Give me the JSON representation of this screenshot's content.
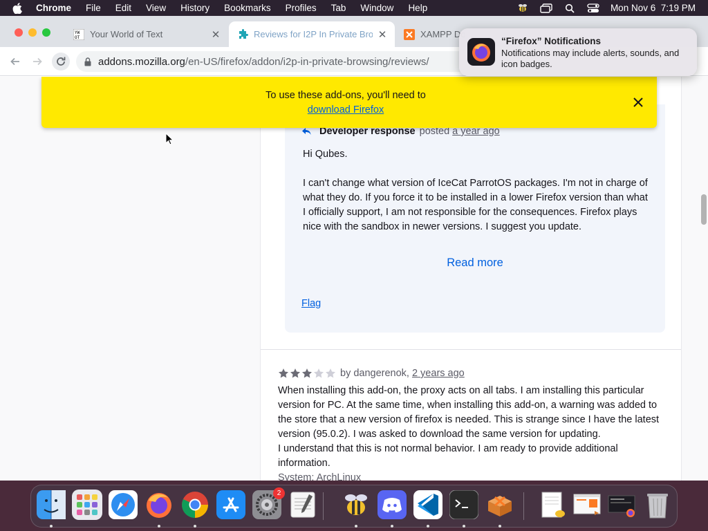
{
  "menubar": {
    "app_name": "Chrome",
    "items": [
      "File",
      "Edit",
      "View",
      "History",
      "Bookmarks",
      "Profiles",
      "Tab",
      "Window",
      "Help"
    ],
    "clock": "Mon Nov 6  7:19 PM"
  },
  "tabs": [
    {
      "title": "Your World of Text",
      "favicon": "ywot-favicon"
    },
    {
      "title": "Reviews for I2P In Private Brow",
      "favicon": "addons-puzzle-favicon",
      "active": true
    },
    {
      "title": "XAMPP Do",
      "favicon": "xampp-favicon"
    }
  ],
  "address_bar": {
    "host": "addons.mozilla.org",
    "path": "/en-US/firefox/addon/i2p-in-private-browsing/reviews/"
  },
  "banner": {
    "text": "To use these add-ons, you'll need to",
    "link": "download Firefox"
  },
  "developer_response": {
    "label": "Developer response",
    "posted": "posted",
    "date": "a year ago",
    "greeting": "Hi Qubes.",
    "body": "I can't change what version of IceCat ParrotOS packages. I'm not in charge of what they do. If you force it to be installed in a lower Firefox version than what I officially support, I am not responsible for the consequences. Firefox plays nice with the sandbox in newer versions. I suggest you update.",
    "read_more": "Read more",
    "flag": "Flag"
  },
  "review": {
    "rating": 3,
    "max_rating": 5,
    "author": "by dangerenok,",
    "date": "2 years ago",
    "body": "When installing this add-on, the proxy acts on all tabs. I am installing this particular version for PC. At the same time, when installing this add-on, a warning was added to the store that a new version of firefox is needed. This is strange since I have the latest version (95.0.2). I was asked to download the same version for updating.",
    "body2": "I understand that this is not normal behavior. I am ready to provide additional information.",
    "system": "System: ArchLinux"
  },
  "notification": {
    "title": "“Firefox” Notifications",
    "body": "Notifications may include alerts, sounds, and icon badges."
  },
  "dock": {
    "settings_badge": "2"
  },
  "colors": {
    "banner_yellow": "#ffe900",
    "link_blue": "#0060df",
    "star_filled": "#6b6b75",
    "star_empty": "#cfcfd8"
  }
}
